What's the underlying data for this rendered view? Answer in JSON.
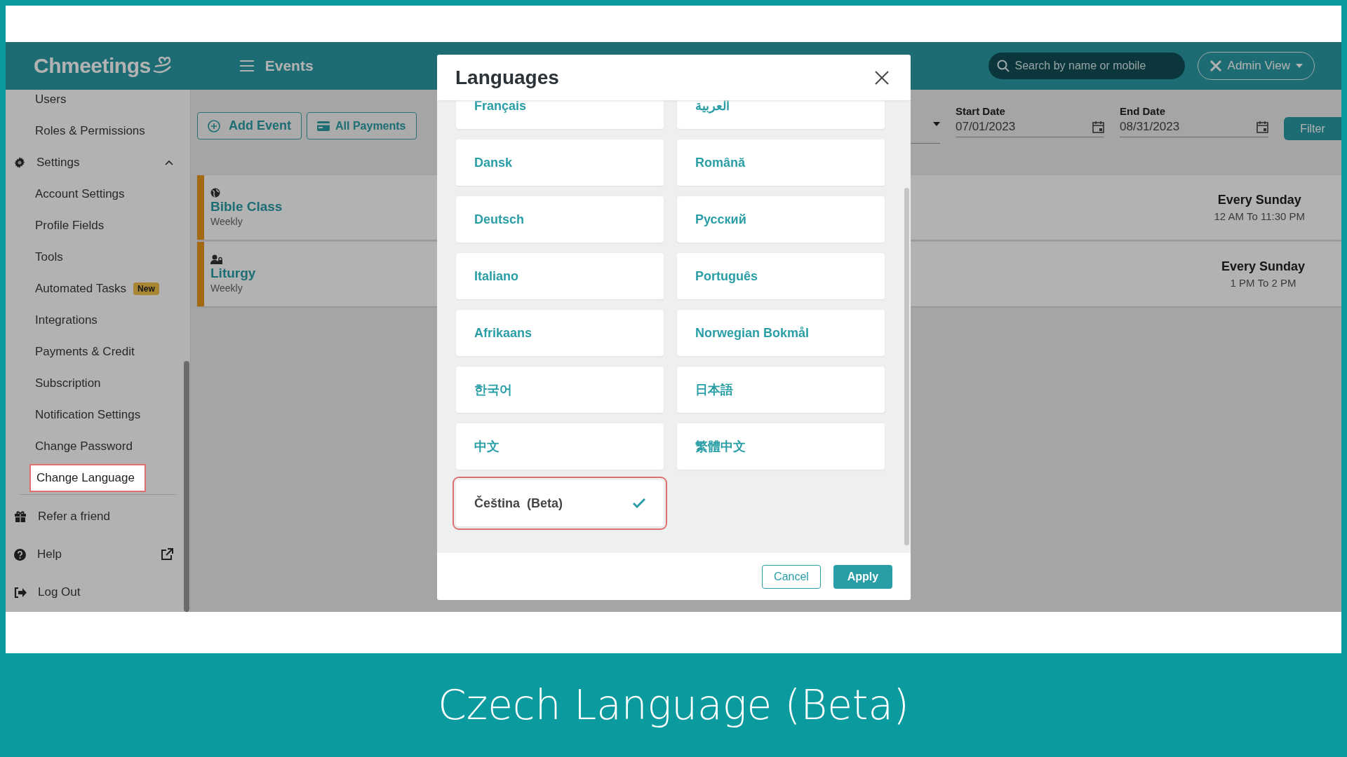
{
  "header": {
    "logo": "Chmeetings",
    "page_title": "Events",
    "search": {
      "placeholder": "Search by name or mobile"
    },
    "view_button": "Admin View"
  },
  "sidebar": {
    "top_items": [
      {
        "label": "Users",
        "selected": false
      },
      {
        "label": "Roles & Permissions",
        "selected": false
      }
    ],
    "settings": {
      "label": "Settings",
      "expanded": true,
      "children": [
        {
          "label": "Account Settings",
          "selected": false
        },
        {
          "label": "Profile Fields",
          "selected": false
        },
        {
          "label": "Tools",
          "selected": false
        },
        {
          "label": "Automated Tasks",
          "badge": "New",
          "selected": false
        },
        {
          "label": "Integrations",
          "selected": false
        },
        {
          "label": "Payments & Credit",
          "selected": false
        },
        {
          "label": "Subscription",
          "selected": false
        },
        {
          "label": "Notification Settings",
          "selected": false
        },
        {
          "label": "Change Password",
          "selected": false
        },
        {
          "label": "Change Language",
          "selected": true
        }
      ]
    },
    "bottom_items": [
      {
        "label": "Refer a friend",
        "kind": "gift"
      },
      {
        "label": "Help",
        "kind": "help"
      },
      {
        "label": "Log Out",
        "kind": "logout"
      }
    ]
  },
  "toolbar": {
    "buttons": [
      {
        "label": "Add Event",
        "kind": "add"
      },
      {
        "label": "All Payments",
        "kind": "payments"
      }
    ]
  },
  "filters": {
    "start_date": {
      "label": "Start Date",
      "value": "07/01/2023"
    },
    "end_date": {
      "label": "End Date",
      "value": "08/31/2023"
    },
    "filter_button": "Filter"
  },
  "events": [
    {
      "title": "Bible Class",
      "recurrence": "Weekly",
      "kind": "public",
      "day": "Every Sunday",
      "time": "12 AM To 11:30 PM"
    },
    {
      "title": "Liturgy",
      "recurrence": "Weekly",
      "kind": "private",
      "day": "Every Sunday",
      "time": "1 PM To 2 PM"
    }
  ],
  "modal": {
    "title": "Languages",
    "languages": [
      {
        "label": "Français",
        "selected": false
      },
      {
        "label": "العربية",
        "selected": false
      },
      {
        "label": "Dansk",
        "selected": false
      },
      {
        "label": "Română",
        "selected": false
      },
      {
        "label": "Deutsch",
        "selected": false
      },
      {
        "label": "Русский",
        "selected": false
      },
      {
        "label": "Italiano",
        "selected": false
      },
      {
        "label": "Português",
        "selected": false
      },
      {
        "label": "Afrikaans",
        "selected": false
      },
      {
        "label": "Norwegian Bokmål",
        "selected": false
      },
      {
        "label": "한국어",
        "selected": false
      },
      {
        "label": "日本語",
        "selected": false
      },
      {
        "label": "中文",
        "selected": false
      },
      {
        "label": "繁體中文",
        "selected": false
      },
      {
        "label": "Čeština  (Beta)",
        "selected": true
      }
    ],
    "cancel_button": "Cancel",
    "apply_button": "Apply"
  },
  "caption": "Czech Language (Beta)"
}
